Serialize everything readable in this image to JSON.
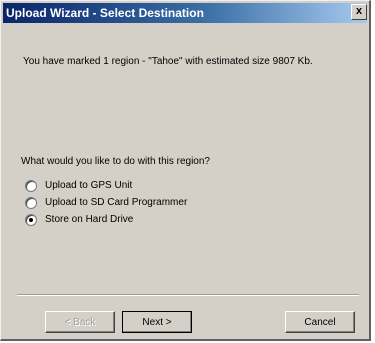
{
  "window": {
    "title": "Upload Wizard - Select Destination",
    "close_label": "x"
  },
  "content": {
    "message": "You have marked 1 region - \"Tahoe\" with estimated size 9807 Kb.",
    "question": "What would you like to do with this region?",
    "options": [
      {
        "label": "Upload to GPS Unit",
        "selected": false
      },
      {
        "label": "Upload to SD Card Programmer",
        "selected": false
      },
      {
        "label": "Store on Hard Drive",
        "selected": true
      }
    ]
  },
  "buttons": {
    "back": "< Back",
    "next": "Next >",
    "cancel": "Cancel"
  },
  "colors": {
    "titlebar_start": "#0a246a",
    "titlebar_end": "#a6caf0",
    "dialog_bg": "#d4d0c8"
  }
}
